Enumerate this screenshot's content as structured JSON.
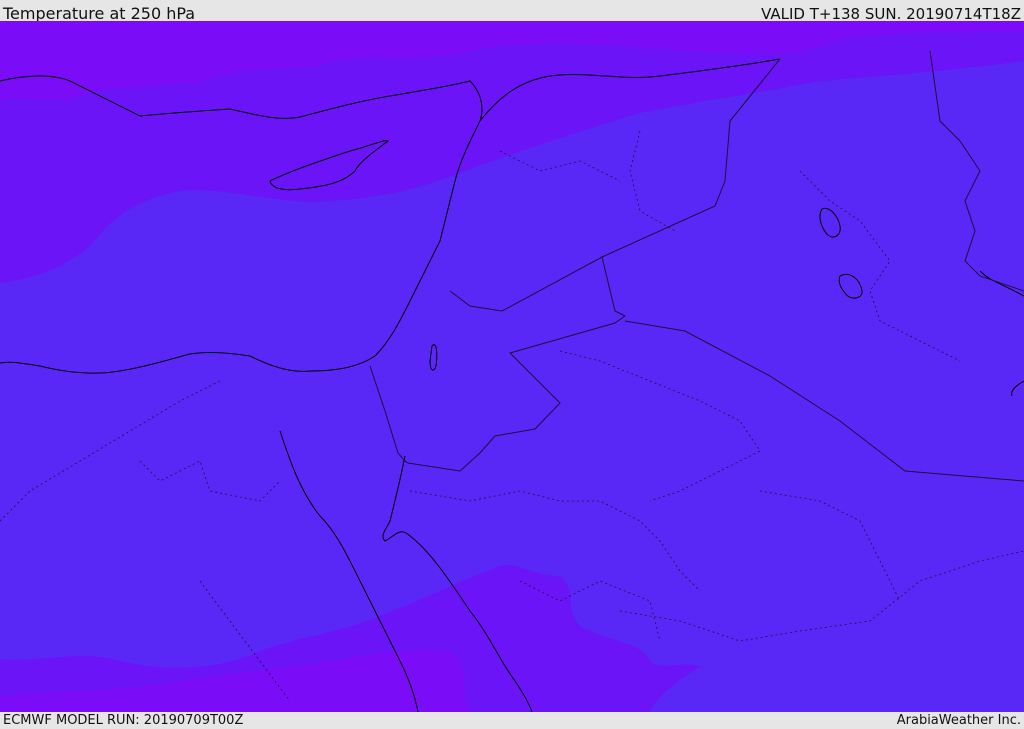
{
  "header": {
    "title": "Temperature at 250 hPa",
    "valid": "VALID T+138 SUN. 20190714T18Z"
  },
  "footer": {
    "model_run": "ECMWF MODEL RUN: 20190709T00Z",
    "credit": "ArabiaWeather Inc."
  },
  "map": {
    "field": "temperature",
    "level": "250 hPa",
    "colors": {
      "colder_band": "#7a0cf8",
      "base_band": "#5a28f6",
      "coastline": "#000000",
      "border": "#1a1040"
    }
  }
}
